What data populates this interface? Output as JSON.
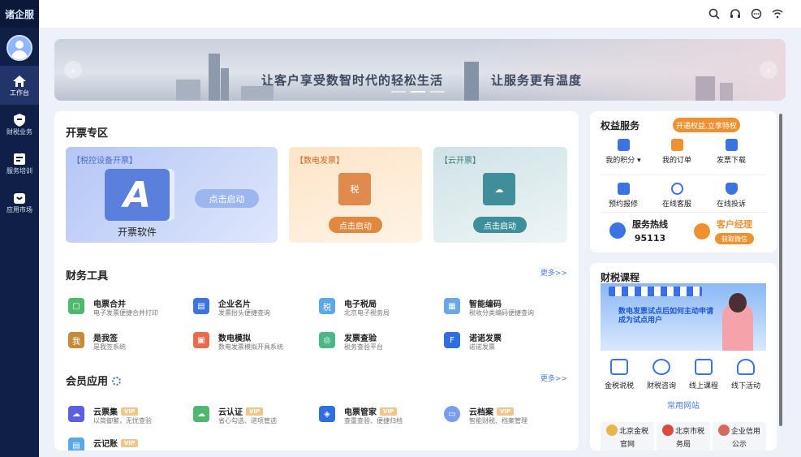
{
  "app": {
    "brand": "诸企服"
  },
  "sidebar": {
    "items": [
      {
        "label": "工作台",
        "icon": "home-icon"
      },
      {
        "label": "财税业务",
        "icon": "shield-icon"
      },
      {
        "label": "服务培训",
        "icon": "training-icon"
      },
      {
        "label": "应用市场",
        "icon": "store-icon"
      }
    ]
  },
  "topbar": {
    "icons": [
      "search-icon",
      "headset-icon",
      "more-icon",
      "wifi-icon"
    ]
  },
  "banner": {
    "text1": "让客户享受数智时代的轻松生活",
    "text2": "让服务更有温度",
    "prev": "‹",
    "next": "›"
  },
  "invoice": {
    "title": "开票专区",
    "tile_a": {
      "label": "【税控设备开票】",
      "name": "开票软件",
      "button": "点击启动",
      "logo": "A"
    },
    "tile_b": {
      "label": "【数电发票】",
      "button": "点击启动",
      "icon_text": "税"
    },
    "tile_c": {
      "label": "【云开票】",
      "button": "点击启动",
      "icon_text": "☁"
    }
  },
  "tools": {
    "title": "财务工具",
    "more": "更多>>",
    "items": [
      {
        "name": "电票合并",
        "desc": "电子发票便捷合并打印",
        "color": "#4fb86f"
      },
      {
        "name": "企业名片",
        "desc": "发票抬头便捷查询",
        "color": "#3b73e3"
      },
      {
        "name": "电子税局",
        "desc": "北京电子税务局",
        "color": "#5aa8e8"
      },
      {
        "name": "智能编码",
        "desc": "税收分类编码便捷查询",
        "color": "#6aa7e6"
      },
      {
        "name": "是我签",
        "desc": "是我签系统",
        "color": "#c58a3a"
      },
      {
        "name": "数电模拟",
        "desc": "数电发票模拟开具系统",
        "color": "#ea6a4a"
      },
      {
        "name": "发票查验",
        "desc": "税务查验平台",
        "color": "#49b886"
      },
      {
        "name": "诺诺发票",
        "desc": "诺诺发票",
        "color": "#2f6ee0"
      }
    ]
  },
  "members": {
    "title": "会员应用",
    "more": "更多>>",
    "items": [
      {
        "name": "云票集",
        "desc": "以简御繁，无忧查验",
        "vip": "VIP",
        "color": "#5b5fe0"
      },
      {
        "name": "云认证",
        "desc": "省心勾选、进项管选",
        "vip": "VIP",
        "color": "#4fb86f"
      },
      {
        "name": "电票管家",
        "desc": "查重查验、便捷归档",
        "vip": "VIP",
        "color": "#2f6ee0"
      },
      {
        "name": "云档案",
        "desc": "智能财税、档案管理",
        "vip": "VIP",
        "color": "#7a9df2"
      },
      {
        "name": "云记账",
        "desc": "",
        "vip": "VIP",
        "color": "#5aa8e8"
      }
    ]
  },
  "rights": {
    "title": "权益服务",
    "promo": "开通权益,立享特权",
    "row1": [
      {
        "label": "我的积分 ▾",
        "icon": "points-icon"
      },
      {
        "label": "我的订单",
        "icon": "order-icon"
      },
      {
        "label": "发票下载",
        "icon": "download-icon"
      }
    ],
    "row2": [
      {
        "label": "预约报修",
        "icon": "toolbox-icon"
      },
      {
        "label": "在线客服",
        "icon": "headset-icon"
      },
      {
        "label": "在线投诉",
        "icon": "alert-icon"
      }
    ],
    "hotline_label": "服务热线",
    "hotline_number": "95113",
    "manager_label": "客户经理",
    "wechat_button": "获取微信"
  },
  "courses": {
    "title": "财税课程",
    "image_text": "数电发票试点后如何主动申请成为试点用户",
    "items": [
      "金税说税",
      "财税咨询",
      "线上课程",
      "线下活动"
    ],
    "sites_title": "常用网站",
    "sites": [
      {
        "line1": "北京金税",
        "line2": "官网"
      },
      {
        "line1": "北京市税",
        "line2": "务局"
      },
      {
        "line1": "企业信用",
        "line2": "公示"
      }
    ]
  }
}
